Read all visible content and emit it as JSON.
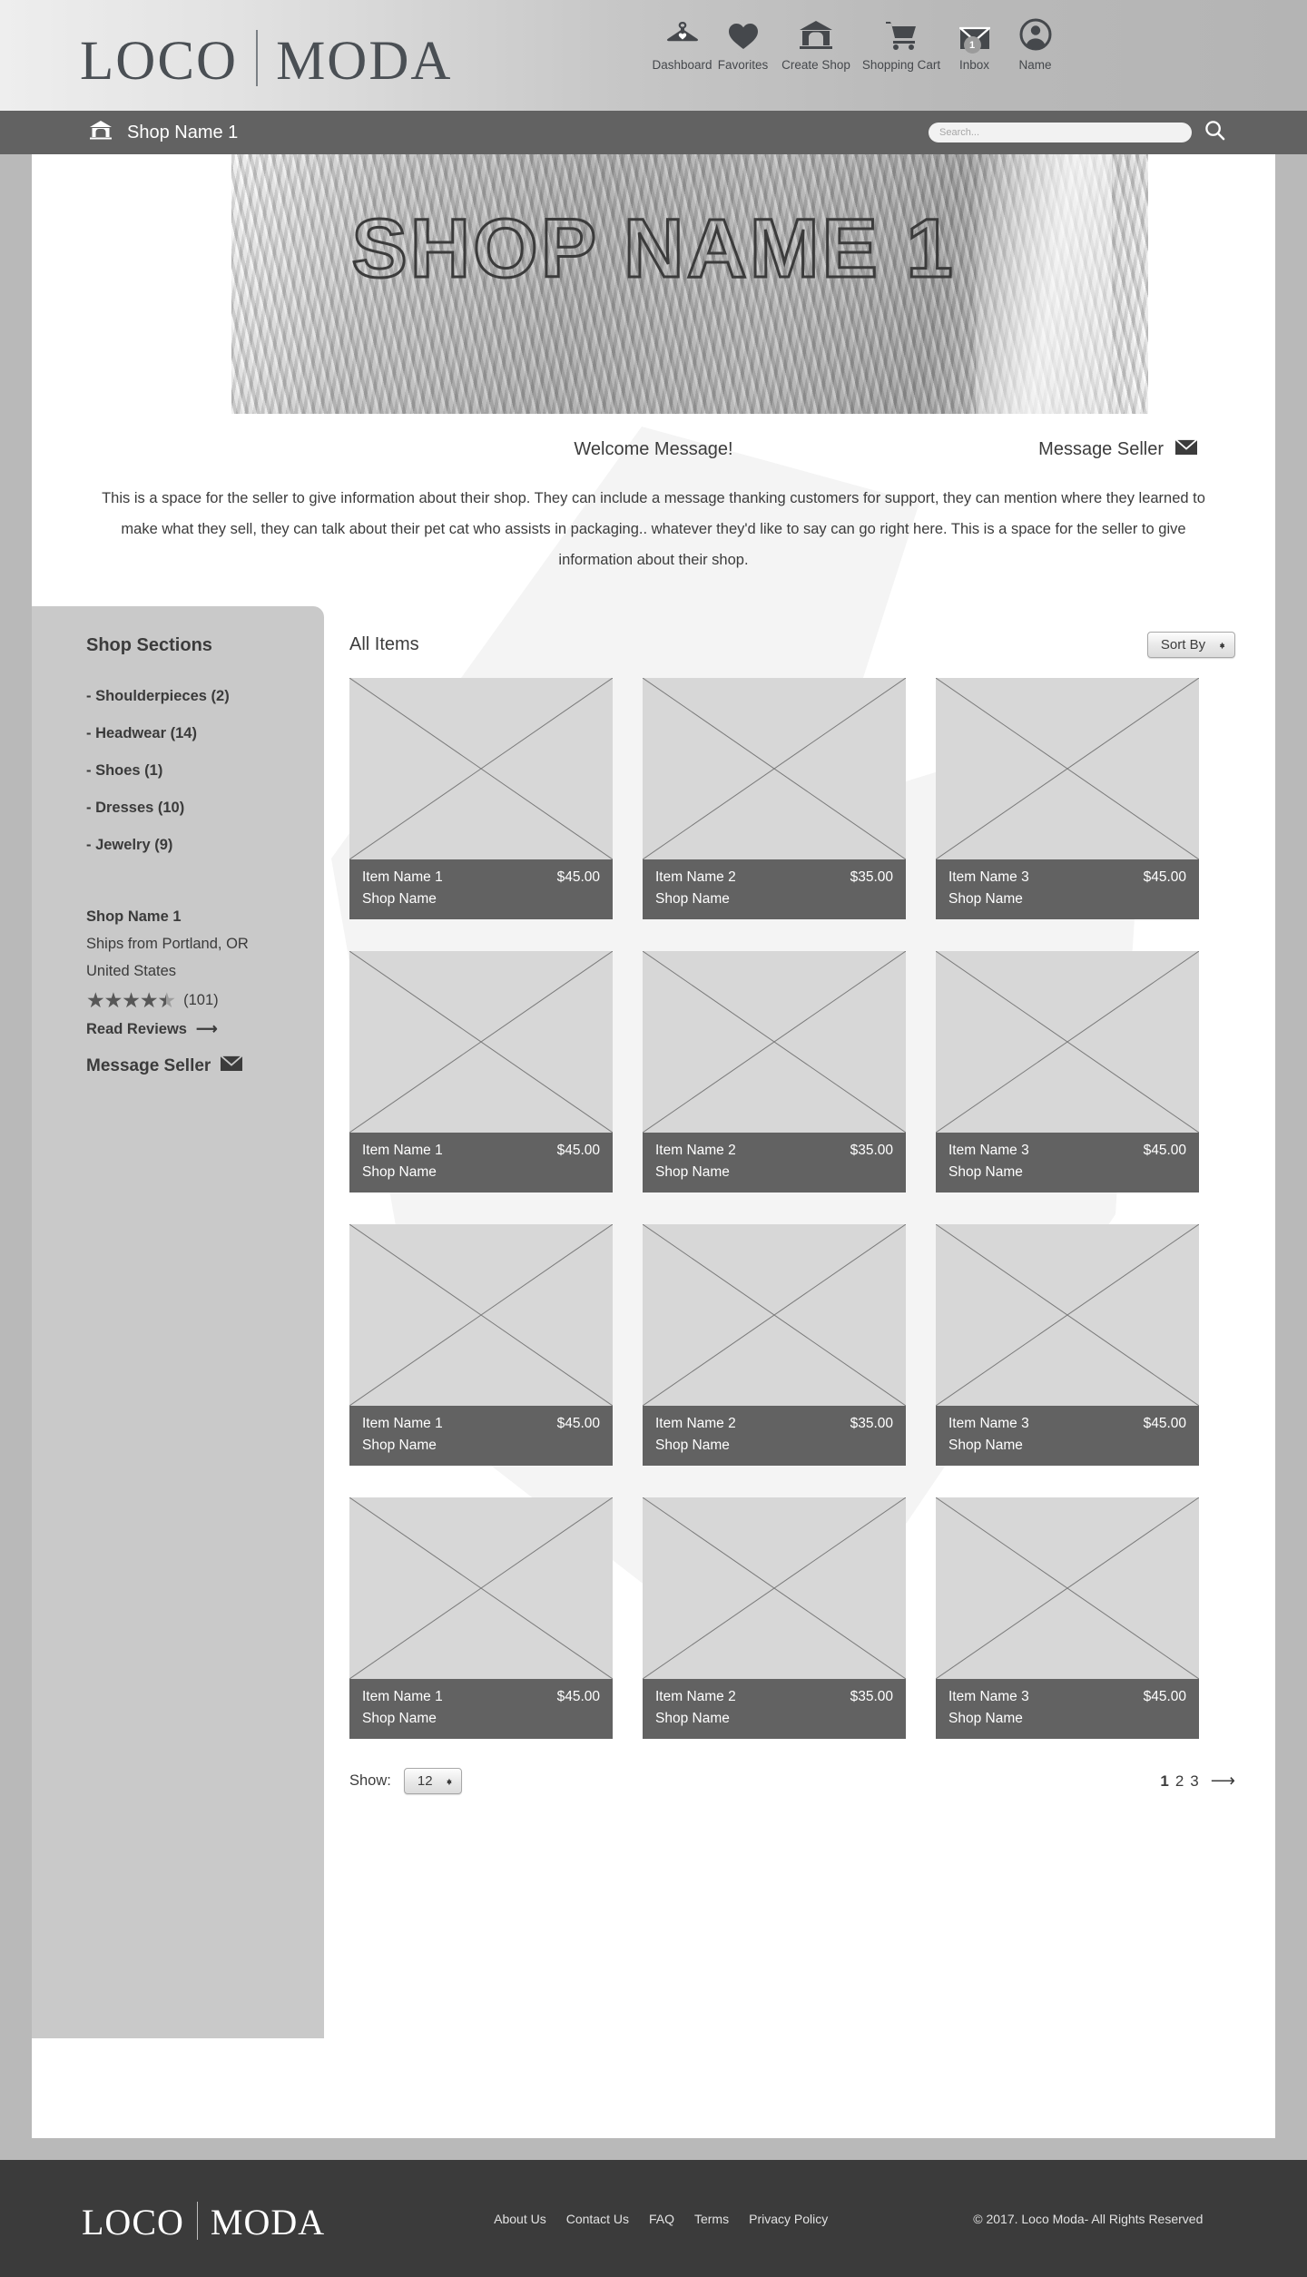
{
  "brand": {
    "word1": "LOCO",
    "word2": "MODA"
  },
  "nav": [
    {
      "label": "Dashboard",
      "icon": "hanger-heart-icon"
    },
    {
      "label": "Favorites",
      "icon": "heart-icon"
    },
    {
      "label": "Create Shop",
      "icon": "shop-house-icon"
    },
    {
      "label": "Shopping Cart",
      "icon": "shopping-cart-icon"
    },
    {
      "label": "Inbox",
      "icon": "envelope-icon",
      "badge": "1"
    },
    {
      "label": "Name",
      "icon": "user-avatar-icon"
    }
  ],
  "shopbar": {
    "shop_name": "Shop Name 1",
    "home_icon": "shop-house-icon"
  },
  "search": {
    "placeholder": "Search...",
    "value": "",
    "icon": "search-icon"
  },
  "hero": {
    "title": "SHOP NAME 1"
  },
  "welcome": {
    "title": "Welcome Message!",
    "message_seller": "Message Seller",
    "body": "This is a space for the seller to give information about their shop.  They can include a message thanking customers for support, they can mention where they learned to make what they sell, they can talk about their pet cat who assists in packaging.. whatever they'd like to say can go right here.  This is a space for the seller to give information about their shop."
  },
  "sidebar": {
    "title": "Shop Sections",
    "sections": [
      "- Shoulderpieces (2)",
      "- Headwear (14)",
      "- Shoes (1)",
      "- Dresses (10)",
      "- Jewelry (9)"
    ],
    "shop_name": "Shop Name 1",
    "ships_from": "Ships from Portland, OR",
    "country": "United States",
    "rating": 4.5,
    "review_count": "(101)",
    "read_reviews": "Read Reviews",
    "message_seller": "Message Seller"
  },
  "main": {
    "heading": "All Items",
    "sort_by": "Sort By",
    "show_label": "Show:",
    "show_value": "12",
    "pages": [
      "1",
      "2",
      "3"
    ],
    "active_page": "1"
  },
  "products": [
    {
      "name": "Item Name 1",
      "price": "$45.00",
      "shop": "Shop Name"
    },
    {
      "name": "Item Name 2",
      "price": "$35.00",
      "shop": "Shop Name"
    },
    {
      "name": "Item Name 3",
      "price": "$45.00",
      "shop": "Shop Name"
    },
    {
      "name": "Item Name 1",
      "price": "$45.00",
      "shop": "Shop Name"
    },
    {
      "name": "Item Name 2",
      "price": "$35.00",
      "shop": "Shop Name"
    },
    {
      "name": "Item Name 3",
      "price": "$45.00",
      "shop": "Shop Name"
    },
    {
      "name": "Item Name 1",
      "price": "$45.00",
      "shop": "Shop Name"
    },
    {
      "name": "Item Name 2",
      "price": "$35.00",
      "shop": "Shop Name"
    },
    {
      "name": "Item Name 3",
      "price": "$45.00",
      "shop": "Shop Name"
    },
    {
      "name": "Item Name 1",
      "price": "$45.00",
      "shop": "Shop Name"
    },
    {
      "name": "Item Name 2",
      "price": "$35.00",
      "shop": "Shop Name"
    },
    {
      "name": "Item Name 3",
      "price": "$45.00",
      "shop": "Shop Name"
    }
  ],
  "footer": {
    "links": [
      "About Us",
      "Contact Us",
      "FAQ",
      "Terms",
      "Privacy Policy"
    ],
    "copyright": "© 2017.  Loco Moda- All Rights Reserved"
  },
  "colors": {
    "page_bg": "#b9b9b9",
    "bar_gray": "#626262",
    "footer_dark": "#3b3b3b",
    "sidebar_gray": "#c9c9c9",
    "placeholder_gray": "#d7d7d7"
  }
}
